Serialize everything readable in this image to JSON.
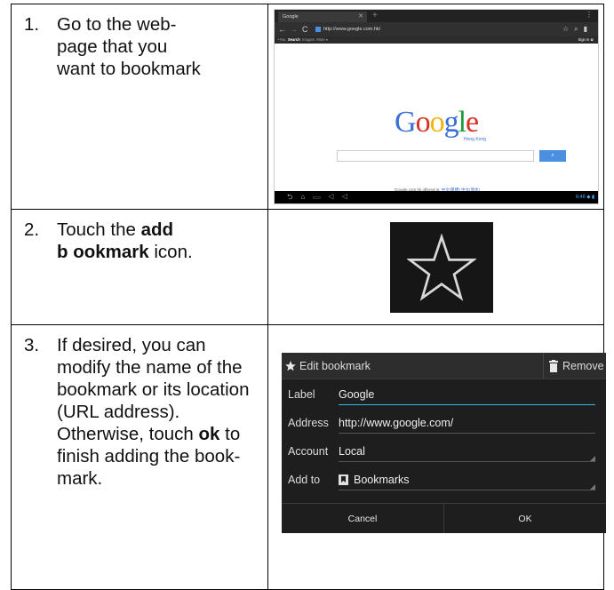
{
  "steps": [
    {
      "number": "1.",
      "lines": [
        "Go to the web-",
        "page that you",
        "want to bookmark"
      ]
    },
    {
      "number": "2.",
      "pre": "Touch the ",
      "bold1": "add",
      "bold2": "b ookmark",
      "post": " icon."
    },
    {
      "number": "3.",
      "pre": "If desired, you can modify the name of the bookmark or its location (URL address). Otherwise, touch ",
      "bold": "ok",
      "post": "  to finish adding the book-mark."
    }
  ],
  "browser": {
    "tab_title": "Google",
    "url": "http://www.google.com.hk/",
    "gbar_left": "+You",
    "gbar_search": "Search",
    "gbar_images": "Images",
    "gbar_more": "More",
    "gbar_signin": "Sign in",
    "logo_letters": [
      "G",
      "o",
      "o",
      "g",
      "l",
      "e"
    ],
    "logo_sub": "Hong Kong",
    "footer_prefix": "Google.com.hk offered in:",
    "footer_lang1": "中文(繁體)",
    "footer_lang2": "中文(简体)",
    "clock": "6:46"
  },
  "dialog": {
    "title": "Edit bookmark",
    "remove": "Remove",
    "label_label": "Label",
    "label_value": "Google",
    "address_label": "Address",
    "address_value": "http://www.google.com/",
    "account_label": "Account",
    "account_value": "Local",
    "addto_label": "Add to",
    "addto_value": "Bookmarks",
    "cancel": "Cancel",
    "ok": "OK"
  },
  "colors": {
    "accent": "#33b5e5",
    "dialog_bg": "#1e1e1e",
    "google_blue": "#3b6fd8",
    "google_red": "#d93025",
    "google_yellow": "#f2b409",
    "google_green": "#1a9b3c"
  }
}
